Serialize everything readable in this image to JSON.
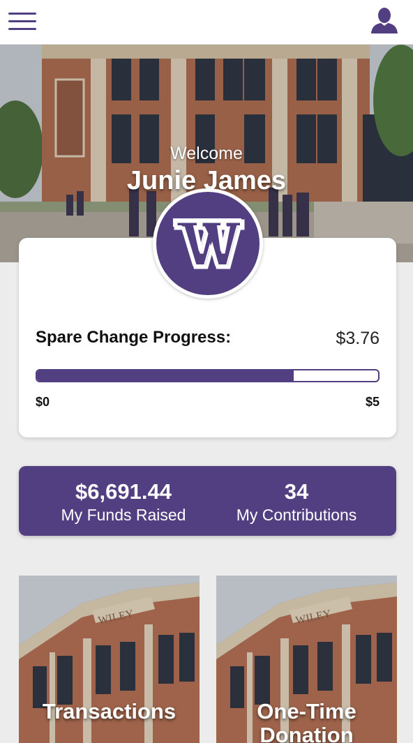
{
  "header": {
    "menu_icon": "hamburger-menu-icon",
    "profile_icon": "user-profile-icon"
  },
  "hero": {
    "welcome": "Welcome",
    "user_name": "Junie James",
    "logo_letter": "W"
  },
  "progress": {
    "label": "Spare Change Progress:",
    "amount": "$3.76",
    "min_label": "$0",
    "max_label": "$5",
    "fraction": 0.752
  },
  "stats": {
    "funds_value": "$6,691.44",
    "funds_label": "My Funds Raised",
    "contrib_value": "34",
    "contrib_label": "My Contributions"
  },
  "tiles": [
    {
      "label": "Transactions",
      "sign_text": "WILEY"
    },
    {
      "label": "One-Time Donation",
      "sign_text": "WILEY"
    }
  ],
  "colors": {
    "brand": "#523f82",
    "background": "#ececec"
  }
}
